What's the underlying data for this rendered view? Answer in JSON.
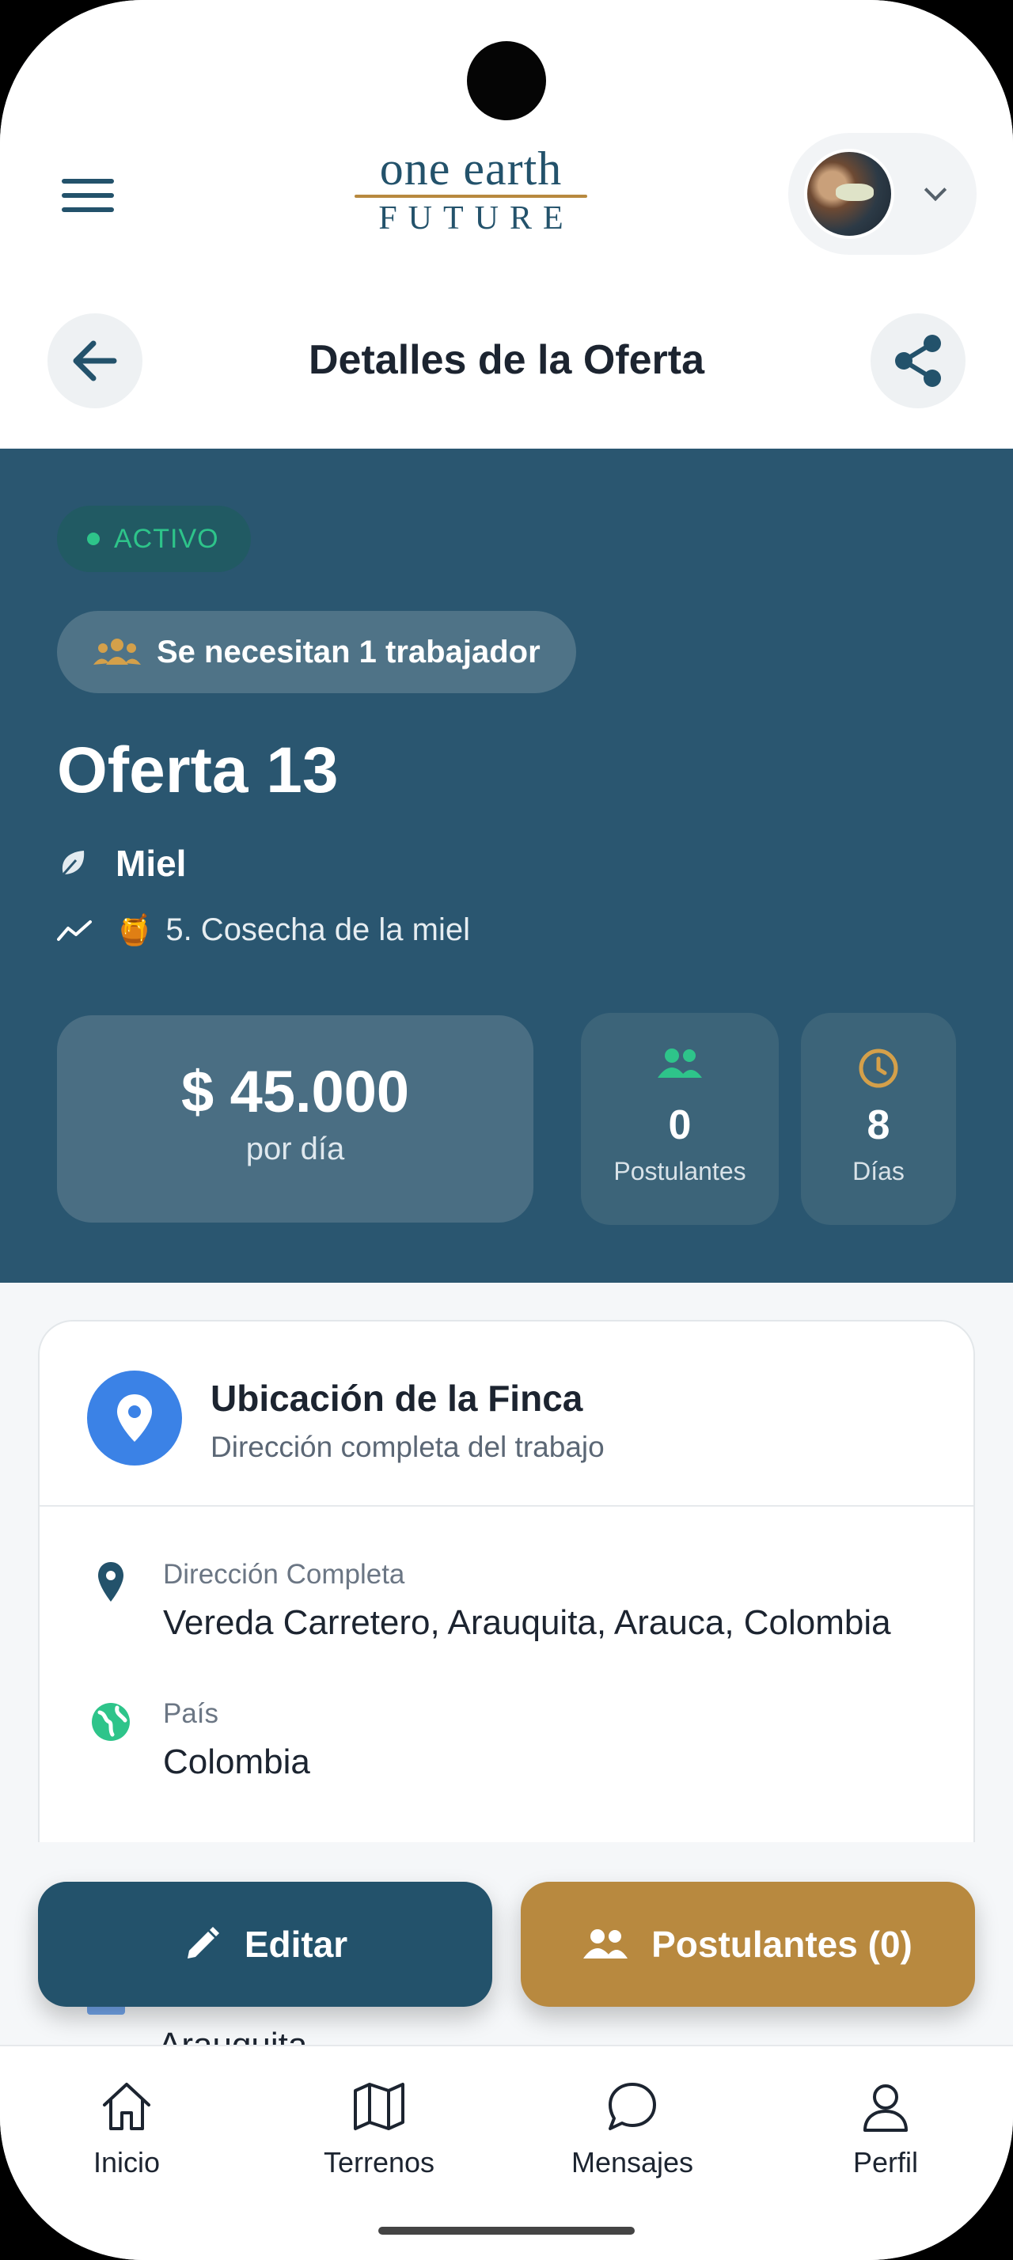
{
  "app": {
    "logo_top": "one earth",
    "logo_bottom": "FUTURE"
  },
  "header": {
    "title": "Detalles de la Oferta"
  },
  "offer": {
    "status": "ACTIVO",
    "workers_needed": "Se necesitan 1 trabajador",
    "title": "Oferta 13",
    "crop": "Miel",
    "stage_emoji": "🍯",
    "stage": "5. Cosecha de la miel",
    "price": "$ 45.000",
    "price_unit": "por día",
    "applicants_count": "0",
    "applicants_label": "Postulantes",
    "days_count": "8",
    "days_label": "Días"
  },
  "location": {
    "title": "Ubicación de la Finca",
    "subtitle": "Dirección completa del trabajo",
    "full_address_label": "Dirección Completa",
    "full_address": "Vereda Carretero, Arauquita, Arauca, Colombia",
    "country_label": "País",
    "country": "Colombia",
    "municipality_partial": "Arauquita"
  },
  "actions": {
    "edit": "Editar",
    "applicants": "Postulantes (0)"
  },
  "nav": {
    "home": "Inicio",
    "lands": "Terrenos",
    "messages": "Mensajes",
    "profile": "Perfil"
  },
  "colors": {
    "primary": "#23526b",
    "accent": "#b8893f",
    "success": "#2ec48a",
    "info": "#3b82e6"
  },
  "icons": [
    "menu-icon",
    "chevron-down-icon",
    "arrow-left-icon",
    "share-icon",
    "users-icon",
    "leaf-icon",
    "trend-icon",
    "clock-icon",
    "map-pin-icon",
    "globe-icon",
    "pencil-icon",
    "home-icon",
    "map-icon",
    "chat-icon",
    "user-icon"
  ]
}
